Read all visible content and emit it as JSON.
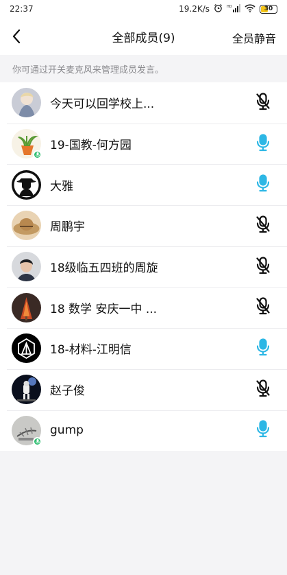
{
  "status_bar": {
    "time": "22:37",
    "network_speed": "19.2K/s",
    "battery_level": "30",
    "icons": [
      "alarm-icon",
      "hd-icon",
      "signal-icon",
      "wifi-icon",
      "battery-icon"
    ]
  },
  "header": {
    "title": "全部成员(9)",
    "mute_all_label": "全员静音",
    "back_icon": "chevron-left-icon"
  },
  "hint": "你可通过开关麦克风来管理成员发言。",
  "colors": {
    "mic_on": "#2db7e5",
    "mic_off": "#111111",
    "badge": "#2bbd6e"
  },
  "members": [
    {
      "name": "今天可以回学校上...",
      "mic_on": false,
      "speaking_badge": false,
      "avatar": "anime-figure"
    },
    {
      "name": "19-国教-何方园",
      "mic_on": true,
      "speaking_badge": true,
      "avatar": "plant-carrot"
    },
    {
      "name": "大雅",
      "mic_on": true,
      "speaking_badge": false,
      "avatar": "man-in-hat-bw"
    },
    {
      "name": "周鹏宇",
      "mic_on": false,
      "speaking_badge": false,
      "avatar": "straw-hat"
    },
    {
      "name": "18级临五四班的周旋",
      "mic_on": false,
      "speaking_badge": false,
      "avatar": "portrait-photo"
    },
    {
      "name": "18 数学 安庆一中 ...",
      "mic_on": false,
      "speaking_badge": false,
      "avatar": "red-tree"
    },
    {
      "name": "18-材料-江明信",
      "mic_on": true,
      "speaking_badge": false,
      "avatar": "linkin-park-logo"
    },
    {
      "name": "赵子俊",
      "mic_on": false,
      "speaking_badge": false,
      "avatar": "astronaut"
    },
    {
      "name": "gump",
      "mic_on": true,
      "speaking_badge": true,
      "avatar": "grey-sketch"
    }
  ]
}
